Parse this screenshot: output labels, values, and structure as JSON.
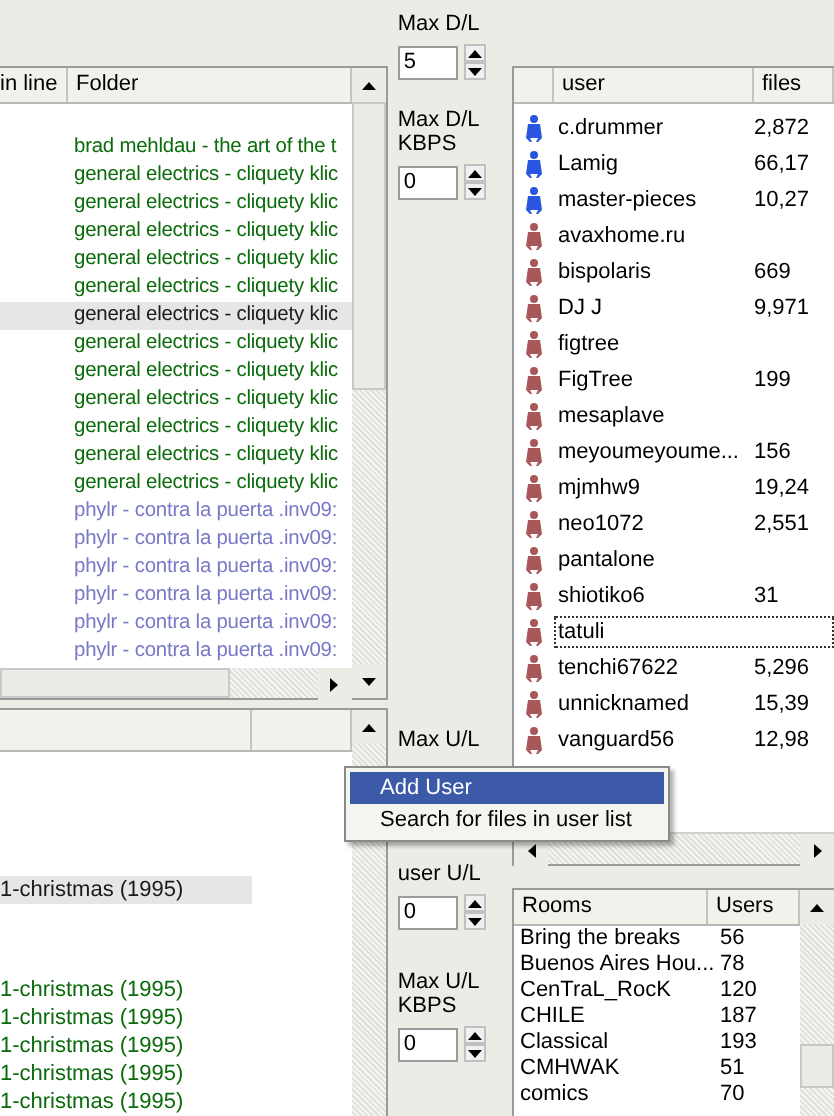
{
  "transfers": {
    "columns": [
      "in line",
      "Folder"
    ],
    "rows": [
      {
        "folder": "brad mehldau - the art of the t",
        "color": "#0a6b0a",
        "selected": false
      },
      {
        "folder": "general electrics - cliquety klic",
        "color": "#0a6b0a",
        "selected": false
      },
      {
        "folder": "general electrics - cliquety klic",
        "color": "#0a6b0a",
        "selected": false
      },
      {
        "folder": "general electrics - cliquety klic",
        "color": "#0a6b0a",
        "selected": false
      },
      {
        "folder": "general electrics - cliquety klic",
        "color": "#0a6b0a",
        "selected": false
      },
      {
        "folder": "general electrics - cliquety klic",
        "color": "#0a6b0a",
        "selected": false
      },
      {
        "folder": "general electrics - cliquety klic",
        "color": "#1a1a1a",
        "selected": true
      },
      {
        "folder": "general electrics - cliquety klic",
        "color": "#0a6b0a",
        "selected": false
      },
      {
        "folder": "general electrics - cliquety klic",
        "color": "#0a6b0a",
        "selected": false
      },
      {
        "folder": "general electrics - cliquety klic",
        "color": "#0a6b0a",
        "selected": false
      },
      {
        "folder": "general electrics - cliquety klic",
        "color": "#0a6b0a",
        "selected": false
      },
      {
        "folder": "general electrics - cliquety klic",
        "color": "#0a6b0a",
        "selected": false
      },
      {
        "folder": "general electrics - cliquety klic",
        "color": "#0a6b0a",
        "selected": false
      },
      {
        "folder": "phylr - contra la puerta .inv09:",
        "color": "#7878c8",
        "selected": false
      },
      {
        "folder": "phylr - contra la puerta .inv09:",
        "color": "#7878c8",
        "selected": false
      },
      {
        "folder": "phylr - contra la puerta .inv09:",
        "color": "#7878c8",
        "selected": false
      },
      {
        "folder": "phylr - contra la puerta .inv09:",
        "color": "#7878c8",
        "selected": false
      },
      {
        "folder": "phylr - contra la puerta .inv09:",
        "color": "#7878c8",
        "selected": false
      },
      {
        "folder": "phylr - contra la puerta .inv09:",
        "color": "#7878c8",
        "selected": false
      }
    ]
  },
  "uploads": {
    "rows": [
      {
        "name": "1-christmas (1995)",
        "color": "#1a1a1a",
        "selected": true
      },
      {
        "name": "1-christmas (1995)",
        "color": "#0a6b0a",
        "selected": false
      },
      {
        "name": "1-christmas (1995)",
        "color": "#0a6b0a",
        "selected": false
      },
      {
        "name": "1-christmas (1995)",
        "color": "#0a6b0a",
        "selected": false
      },
      {
        "name": "1-christmas (1995)",
        "color": "#0a6b0a",
        "selected": false
      },
      {
        "name": "1-christmas (1995)",
        "color": "#0a6b0a",
        "selected": false
      }
    ]
  },
  "download_settings": [
    {
      "label": "Max D/L",
      "value": "5"
    },
    {
      "label": "Max D/L KBPS",
      "value": "0"
    }
  ],
  "upload_settings": {
    "max_label": "Max U/L",
    "extra_label": "user U/L",
    "extra_value": "0",
    "kbps_label": "Max U/L KBPS",
    "kbps_value": "0"
  },
  "users": {
    "columns": [
      "user",
      "files"
    ],
    "rows": [
      {
        "user": "c.drummer",
        "files": "2,872",
        "color": "#2a55e0",
        "focused": false
      },
      {
        "user": "Lamig",
        "files": "66,17",
        "color": "#2a55e0",
        "focused": false
      },
      {
        "user": "master-pieces",
        "files": "10,27",
        "color": "#2a55e0",
        "focused": false
      },
      {
        "user": "avaxhome.ru",
        "color": "#a85858",
        "focused": false
      },
      {
        "user": "bispolaris",
        "files": "669",
        "color": "#a85858",
        "focused": false
      },
      {
        "user": "DJ J",
        "files": "9,971",
        "color": "#a85858",
        "focused": false
      },
      {
        "user": "figtree",
        "color": "#a85858",
        "focused": false
      },
      {
        "user": "FigTree",
        "files": "199",
        "color": "#a85858",
        "focused": false
      },
      {
        "user": "mesaplave",
        "color": "#a85858",
        "focused": false
      },
      {
        "user": "meyoumeyoume...",
        "files": "156",
        "color": "#a85858",
        "focused": false
      },
      {
        "user": "mjmhw9",
        "files": "19,24",
        "color": "#a85858",
        "focused": false
      },
      {
        "user": "neo1072",
        "files": "2,551",
        "color": "#a85858",
        "focused": false
      },
      {
        "user": "pantalone",
        "color": "#a85858",
        "focused": false
      },
      {
        "user": "shiotiko6",
        "files": "31",
        "color": "#a85858",
        "focused": false
      },
      {
        "user": "tatuli",
        "color": "#a85858",
        "focused": true
      },
      {
        "user": "tenchi67622",
        "files": "5,296",
        "color": "#a85858",
        "focused": false
      },
      {
        "user": "unnicknamed",
        "files": "15,39",
        "color": "#a85858",
        "focused": false
      },
      {
        "user": "vanguard56",
        "files": "12,98",
        "color": "#a85858",
        "focused": false
      }
    ]
  },
  "rooms": {
    "columns": [
      "Rooms",
      "Users"
    ],
    "rows": [
      {
        "room": "Bring the breaks",
        "users": "56"
      },
      {
        "room": "Buenos Aires Hou...",
        "users": "78"
      },
      {
        "room": "CenTraL_RocK",
        "users": "120"
      },
      {
        "room": "CHILE",
        "users": "187"
      },
      {
        "room": "Classical",
        "users": "193"
      },
      {
        "room": "CMHWAK",
        "users": "51"
      },
      {
        "room": "comics",
        "users": "70"
      }
    ]
  },
  "context_menu": [
    {
      "label": "Add User",
      "selected": true
    },
    {
      "label": "Search for files in user list",
      "selected": false
    }
  ]
}
